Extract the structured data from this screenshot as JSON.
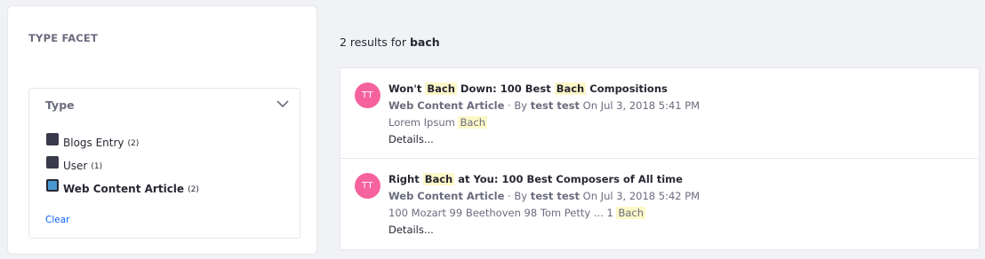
{
  "facet": {
    "heading": "TYPE FACET",
    "panel_title": "Type",
    "items": [
      {
        "label": "Blogs Entry",
        "count": "(2)",
        "checked": false
      },
      {
        "label": "User",
        "count": "(1)",
        "checked": false
      },
      {
        "label": "Web Content Article",
        "count": "(2)",
        "checked": true
      }
    ],
    "clear_label": "Clear"
  },
  "search": {
    "summary_prefix": "2 results for",
    "keyword": "bach"
  },
  "results": [
    {
      "avatar": "TT",
      "title_parts": [
        "Won't ",
        "Bach",
        " Down: 100 Best ",
        "Bach",
        " Compositions"
      ],
      "type": "Web Content Article",
      "by": " · By ",
      "author": "test test",
      "date": " On Jul 3, 2018 5:41 PM",
      "snippet_parts": [
        "Lorem Ipsum ",
        "Bach"
      ],
      "details": "Details..."
    },
    {
      "avatar": "TT",
      "title_parts": [
        "Right ",
        "Bach",
        " at You: 100 Best Composers of All time"
      ],
      "type": "Web Content Article",
      "by": " · By ",
      "author": "test test",
      "date": " On Jul 3, 2018 5:42 PM",
      "snippet_parts": [
        "100 Mozart 99 Beethoven 98 Tom Petty ... 1 ",
        "Bach"
      ],
      "details": "Details..."
    }
  ],
  "colors": {
    "avatar": "#f5629e",
    "highlight": "#fdf8c8",
    "link": "#0b5fff",
    "checked_box": "#4a98d2"
  }
}
